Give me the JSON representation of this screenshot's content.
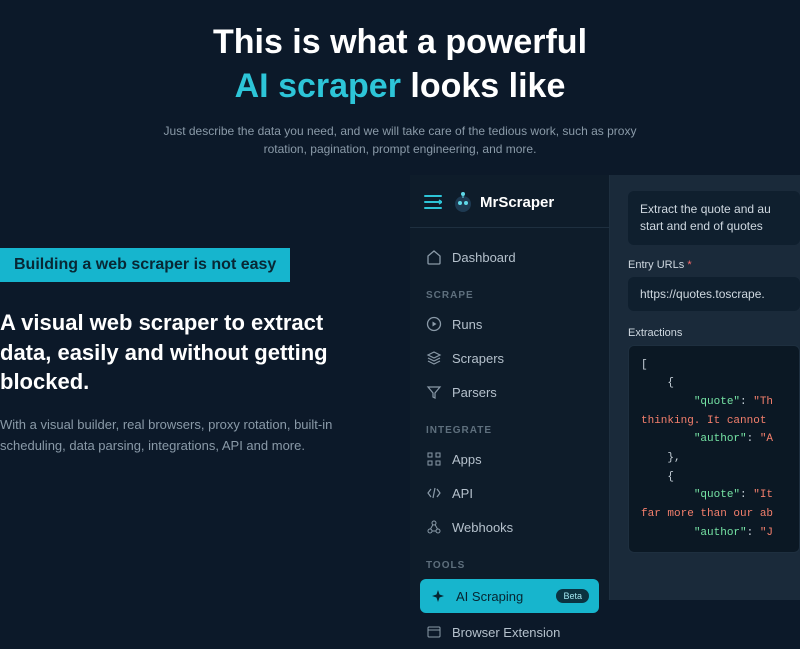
{
  "hero": {
    "line1": "This is what a powerful",
    "highlight": "AI scraper",
    "line2_tail": " looks like",
    "sub": "Just describe the data you need, and we will take care of the tedious work, such as proxy rotation, pagination, prompt engineering, and more."
  },
  "left": {
    "badge": "Building a web scraper is not easy",
    "heading": "A visual web scraper to extract data, easily and without getting blocked.",
    "para": "With a visual builder, real browsers, proxy rotation, built-in scheduling, data parsing, integrations, API and more."
  },
  "brand": {
    "name": "MrScraper"
  },
  "nav": {
    "dashboard": "Dashboard",
    "section_scrape": "SCRAPE",
    "runs": "Runs",
    "scrapers": "Scrapers",
    "parsers": "Parsers",
    "section_integrate": "INTEGRATE",
    "apps": "Apps",
    "api": "API",
    "webhooks": "Webhooks",
    "section_tools": "TOOLS",
    "ai_scraping": "AI Scraping",
    "ai_badge": "Beta",
    "browser_ext": "Browser Extension"
  },
  "detail": {
    "prompt": "Extract the quote and au\nstart and end of quotes",
    "entry_urls_label": "Entry URLs",
    "url_value": "https://quotes.toscrape.",
    "extractions_label": "Extractions",
    "code": {
      "l1": "[",
      "l2": "    {",
      "l3k": "\"quote\"",
      "l3v": "\"Th",
      "l4a": "thinking. It cannot",
      "l5k": "\"author\"",
      "l5v": "\"A",
      "l6": "    },",
      "l7": "    {",
      "l8k": "\"quote\"",
      "l8v": "\"It",
      "l9a": "far more than our ab",
      "l10k": "\"author\"",
      "l10v": "\"J"
    }
  }
}
